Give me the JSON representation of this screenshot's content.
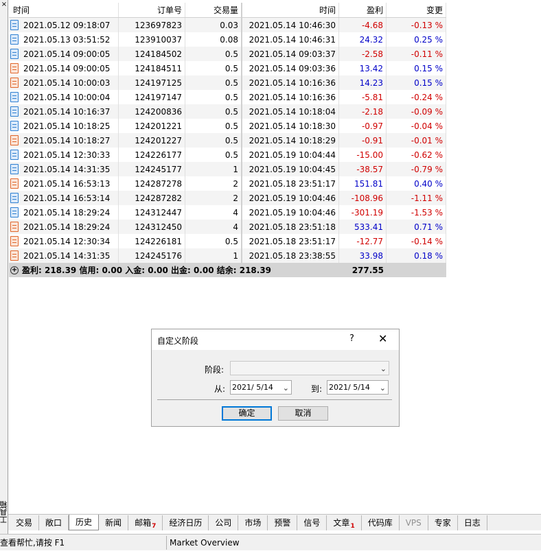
{
  "left_panel": {
    "close_glyph": "×",
    "vertical_label": "工具箱"
  },
  "columns": [
    "时间",
    "订单号",
    "交易量",
    "时间",
    "盈利",
    "变更"
  ],
  "rows": [
    {
      "icon": "blue",
      "open_time": "2021.05.12 09:18:07",
      "order": "123697823",
      "volume": "0.03",
      "close_time": "2021.05.14 10:46:30",
      "profit": "-4.68",
      "change": "-0.13 %"
    },
    {
      "icon": "blue",
      "open_time": "2021.05.13 03:51:52",
      "order": "123910037",
      "volume": "0.08",
      "close_time": "2021.05.14 10:46:31",
      "profit": "24.32",
      "change": "0.25 %"
    },
    {
      "icon": "blue",
      "open_time": "2021.05.14 09:00:05",
      "order": "124184502",
      "volume": "0.5",
      "close_time": "2021.05.14 09:03:37",
      "profit": "-2.58",
      "change": "-0.11 %"
    },
    {
      "icon": "orange",
      "open_time": "2021.05.14 09:00:05",
      "order": "124184511",
      "volume": "0.5",
      "close_time": "2021.05.14 09:03:36",
      "profit": "13.42",
      "change": "0.15 %"
    },
    {
      "icon": "orange",
      "open_time": "2021.05.14 10:00:03",
      "order": "124197125",
      "volume": "0.5",
      "close_time": "2021.05.14 10:16:36",
      "profit": "14.23",
      "change": "0.15 %"
    },
    {
      "icon": "blue",
      "open_time": "2021.05.14 10:00:04",
      "order": "124197147",
      "volume": "0.5",
      "close_time": "2021.05.14 10:16:36",
      "profit": "-5.81",
      "change": "-0.24 %"
    },
    {
      "icon": "blue",
      "open_time": "2021.05.14 10:16:37",
      "order": "124200836",
      "volume": "0.5",
      "close_time": "2021.05.14 10:18:04",
      "profit": "-2.18",
      "change": "-0.09 %"
    },
    {
      "icon": "blue",
      "open_time": "2021.05.14 10:18:25",
      "order": "124201221",
      "volume": "0.5",
      "close_time": "2021.05.14 10:18:30",
      "profit": "-0.97",
      "change": "-0.04 %"
    },
    {
      "icon": "orange",
      "open_time": "2021.05.14 10:18:27",
      "order": "124201227",
      "volume": "0.5",
      "close_time": "2021.05.14 10:18:29",
      "profit": "-0.91",
      "change": "-0.01 %"
    },
    {
      "icon": "blue",
      "open_time": "2021.05.14 12:30:33",
      "order": "124226177",
      "volume": "0.5",
      "close_time": "2021.05.19 10:04:44",
      "profit": "-15.00",
      "change": "-0.62 %"
    },
    {
      "icon": "blue",
      "open_time": "2021.05.14 14:31:35",
      "order": "124245177",
      "volume": "1",
      "close_time": "2021.05.19 10:04:45",
      "profit": "-38.57",
      "change": "-0.79 %"
    },
    {
      "icon": "orange",
      "open_time": "2021.05.14 16:53:13",
      "order": "124287278",
      "volume": "2",
      "close_time": "2021.05.18 23:51:17",
      "profit": "151.81",
      "change": "0.40 %"
    },
    {
      "icon": "blue",
      "open_time": "2021.05.14 16:53:14",
      "order": "124287282",
      "volume": "2",
      "close_time": "2021.05.19 10:04:46",
      "profit": "-108.96",
      "change": "-1.11 %"
    },
    {
      "icon": "blue",
      "open_time": "2021.05.14 18:29:24",
      "order": "124312447",
      "volume": "4",
      "close_time": "2021.05.19 10:04:46",
      "profit": "-301.19",
      "change": "-1.53 %"
    },
    {
      "icon": "orange",
      "open_time": "2021.05.14 18:29:24",
      "order": "124312450",
      "volume": "4",
      "close_time": "2021.05.18 23:51:18",
      "profit": "533.41",
      "change": "0.71 %"
    },
    {
      "icon": "orange",
      "open_time": "2021.05.14 12:30:34",
      "order": "124226181",
      "volume": "0.5",
      "close_time": "2021.05.18 23:51:17",
      "profit": "-12.77",
      "change": "-0.14 %"
    },
    {
      "icon": "orange",
      "open_time": "2021.05.14 14:31:35",
      "order": "124245176",
      "volume": "1",
      "close_time": "2021.05.18 23:38:55",
      "profit": "33.98",
      "change": "0.18 %"
    }
  ],
  "summary": {
    "text": "盈利: 218.39  信用: 0.00  入金: 0.00  出金: 0.00  结余: 218.39",
    "total": "277.55"
  },
  "dialog": {
    "title": "自定义阶段",
    "help_glyph": "?",
    "close_glyph": "✕",
    "period_label": "阶段:",
    "period_value": "",
    "from_label": "从:",
    "from_value": "2021/ 5/14",
    "to_label": "到:",
    "to_value": "2021/ 5/14",
    "ok_label": "确定",
    "cancel_label": "取消"
  },
  "tabs": [
    {
      "label": "交易",
      "badge": "",
      "active": false,
      "dim": false
    },
    {
      "label": "敞口",
      "badge": "",
      "active": false,
      "dim": false
    },
    {
      "label": "历史",
      "badge": "",
      "active": true,
      "dim": false
    },
    {
      "label": "新闻",
      "badge": "",
      "active": false,
      "dim": false
    },
    {
      "label": "邮箱",
      "badge": "7",
      "active": false,
      "dim": false
    },
    {
      "label": "经济日历",
      "badge": "",
      "active": false,
      "dim": false
    },
    {
      "label": "公司",
      "badge": "",
      "active": false,
      "dim": false
    },
    {
      "label": "市场",
      "badge": "",
      "active": false,
      "dim": false
    },
    {
      "label": "预警",
      "badge": "",
      "active": false,
      "dim": false
    },
    {
      "label": "信号",
      "badge": "",
      "active": false,
      "dim": false
    },
    {
      "label": "文章",
      "badge": "1",
      "active": false,
      "dim": false
    },
    {
      "label": "代码库",
      "badge": "",
      "active": false,
      "dim": false
    },
    {
      "label": "VPS",
      "badge": "",
      "active": false,
      "dim": true
    },
    {
      "label": "专家",
      "badge": "",
      "active": false,
      "dim": false
    },
    {
      "label": "日志",
      "badge": "",
      "active": false,
      "dim": false
    }
  ],
  "status": {
    "help_text": "查看帮忙,请按 F1",
    "market_text": "Market Overview"
  },
  "colors": {
    "negative": "#d00000",
    "positive": "#0000c8",
    "buy_icon": "#2e7fd1",
    "sell_icon": "#e0662a"
  }
}
